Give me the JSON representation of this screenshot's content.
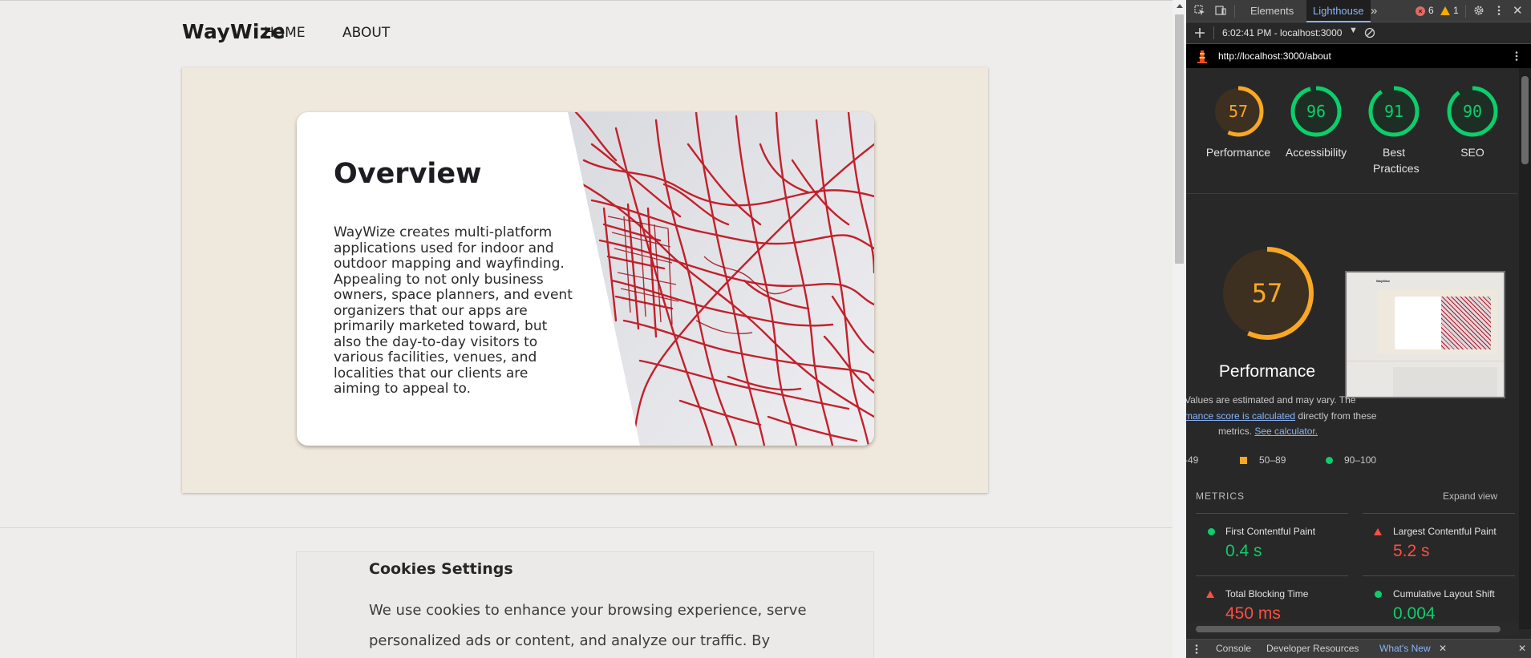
{
  "site": {
    "brand": "WayWize",
    "nav": [
      "HOME",
      "ABOUT"
    ],
    "hero": {
      "title": "Overview",
      "body": "WayWize creates multi-platform applications used for indoor and outdoor mapping and wayfinding. Appealing to not only business owners, space planners, and event organizers that our apps are primarily marketed toward, but also the day-to-day visitors to various facilities, venues, and localities that our clients are aiming to appeal to."
    },
    "cookies": {
      "title": "Cookies Settings",
      "text": "We use cookies to enhance your browsing experience, serve personalized ads or content, and analyze our traffic. By clicking"
    }
  },
  "devtools": {
    "tabs": [
      "Elements",
      "Lighthouse"
    ],
    "active_tab": "Lighthouse",
    "errors": "6",
    "warnings": "1",
    "report_time": "6:02:41 PM - localhost:3000",
    "url": "http://localhost:3000/about",
    "scores": [
      {
        "label": "Performance",
        "value": 57,
        "color": "#f9a825"
      },
      {
        "label": "Accessibility",
        "value": 96,
        "color": "#0cce6b"
      },
      {
        "label": "Best Practices",
        "value": 91,
        "color": "#0cce6b"
      },
      {
        "label": "SEO",
        "value": 90,
        "color": "#0cce6b"
      }
    ],
    "performance": {
      "score": 57,
      "title": "Performance",
      "desc_line1": "Values are estimated and may vary. The",
      "desc_link1": "mance score is calculated",
      "desc_line2": " directly from these",
      "desc_line3": "metrics.",
      "desc_link2": "See calculator.",
      "legend": [
        "-49",
        "50–89",
        "90–100"
      ]
    },
    "metrics": {
      "header": "METRICS",
      "expand": "Expand view",
      "items": [
        {
          "name": "First Contentful Paint",
          "value": "0.4 s",
          "status": "pass"
        },
        {
          "name": "Largest Contentful Paint",
          "value": "5.2 s",
          "status": "fail"
        },
        {
          "name": "Total Blocking Time",
          "value": "450 ms",
          "status": "fail"
        },
        {
          "name": "Cumulative Layout Shift",
          "value": "0.004",
          "status": "pass"
        }
      ]
    },
    "drawer": {
      "tabs": [
        "Console",
        "Developer Resources",
        "What's New"
      ],
      "active": "What's New"
    },
    "colors": {
      "accent": "#8ab4f8",
      "pass": "#0cce6b",
      "average": "#f9a825",
      "fail": "#ff4e42"
    }
  }
}
